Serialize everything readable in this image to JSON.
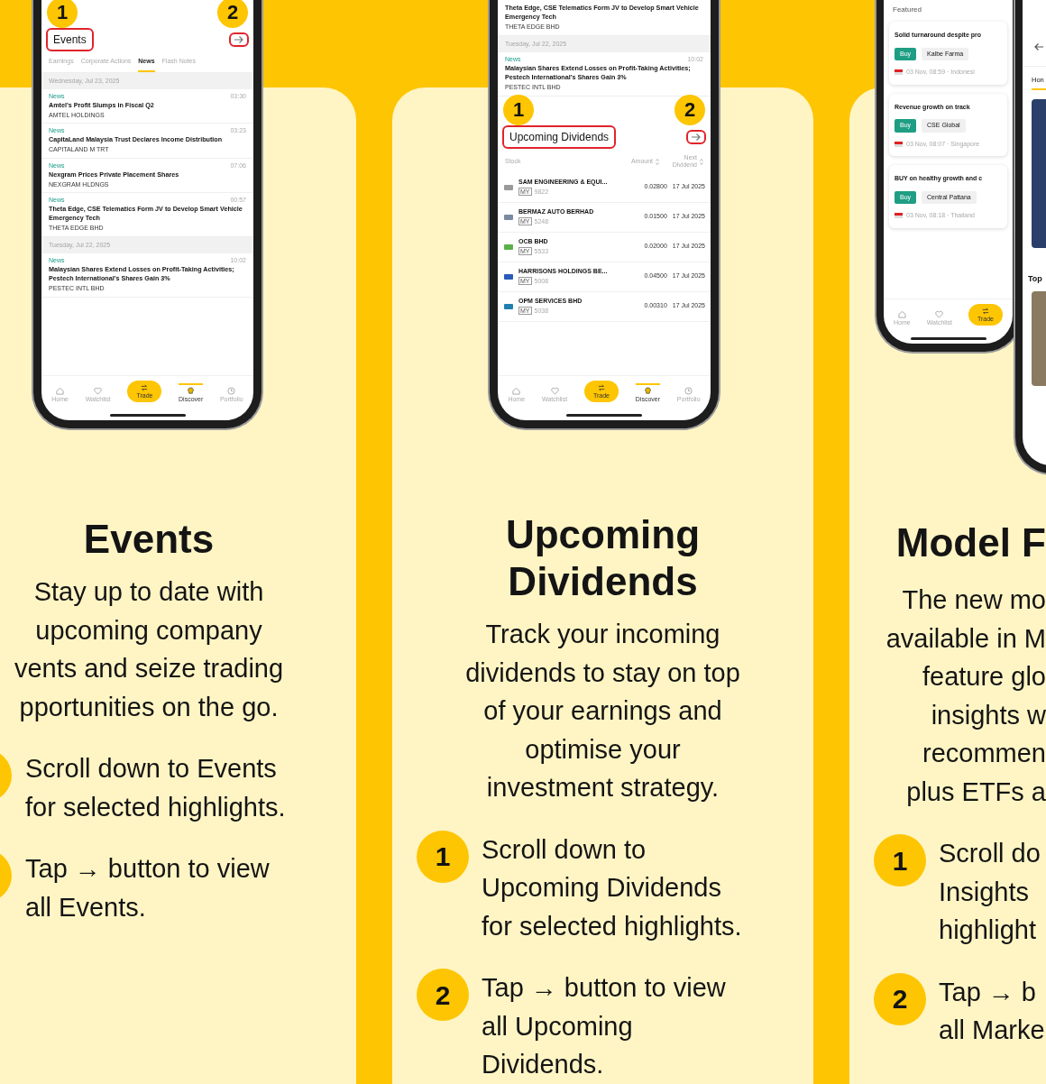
{
  "panels": [
    {
      "phone": {
        "kind": "events",
        "callouts": [
          "1",
          "2"
        ],
        "section_title": "Events",
        "tabs": [
          {
            "label": "Earnings",
            "selected": false
          },
          {
            "label": "Corporate Actions",
            "selected": false
          },
          {
            "label": "News",
            "selected": true
          },
          {
            "label": "Flash Notes",
            "selected": false
          }
        ],
        "feed": [
          {
            "kind": "date",
            "text": "Wednesday, Jul 23, 2025"
          },
          {
            "kind": "item",
            "tag": "News",
            "time": "03:30",
            "title": "Amtel's Profit Slumps in Fiscal Q2",
            "company": "AMTEL HOLDINGS"
          },
          {
            "kind": "item",
            "tag": "News",
            "time": "03:23",
            "title": "CapitaLand Malaysia Trust Declares Income Distribution",
            "company": "CAPITALAND M TRT"
          },
          {
            "kind": "item",
            "tag": "News",
            "time": "07:06",
            "title": "Nexgram Prices Private Placement Shares",
            "company": "NEXGRAM HLDNGS"
          },
          {
            "kind": "item",
            "tag": "News",
            "time": "00:57",
            "title": "Theta Edge, CSE Telematics Form JV to Develop Smart Vehicle Emergency Tech",
            "company": "THETA EDGE BHD"
          },
          {
            "kind": "date",
            "text": "Tuesday, Jul 22, 2025"
          },
          {
            "kind": "item",
            "tag": "News",
            "time": "10:02",
            "title": "Malaysian Shares Extend Losses on Profit-Taking Activities; Pestech International's Shares Gain 3%",
            "company": "PESTEC INTL BHD"
          }
        ],
        "nav": [
          {
            "label": "Home",
            "kind": "tab",
            "selected": false
          },
          {
            "label": "Watchlist",
            "kind": "tab",
            "selected": false
          },
          {
            "label": "Trade",
            "kind": "action",
            "selected": false
          },
          {
            "label": "Discover",
            "kind": "tab",
            "selected": true
          },
          {
            "label": "Portfolio",
            "kind": "tab",
            "selected": false
          }
        ]
      },
      "title": [
        "Events"
      ],
      "description": [
        "Stay up to date with",
        "upcoming company",
        "vents and seize trading",
        "pportunities on the go."
      ],
      "steps": [
        {
          "lines": [
            "Scroll down to Events",
            "for selected highlights."
          ]
        },
        {
          "lines": [
            "Tap → button to view",
            "all Events."
          ]
        }
      ]
    },
    {
      "phone": {
        "kind": "dividends",
        "callouts": [
          "1",
          "2"
        ],
        "section_title": "Upcoming Dividends",
        "feed": [
          {
            "kind": "item",
            "title": "Theta Edge, CSE Telematics Form JV to Develop Smart Vehicle Emergency Tech",
            "company": "THETA EDGE BHD"
          },
          {
            "kind": "date",
            "text": "Tuesday, Jul 22, 2025"
          },
          {
            "kind": "item",
            "tag": "News",
            "time": "10:02",
            "title": "Malaysian Shares Extend Losses on Profit-Taking Activities; Pestech International's Shares Gain 3%",
            "company": "PESTEC INTL BHD"
          }
        ],
        "columns": [
          "Stock",
          "Amount",
          "Next Dividend"
        ],
        "rows": [
          {
            "name": "SAM ENGINEERING & EQUI...",
            "market": "MY",
            "code": "9822",
            "amount": "0.02800",
            "date": "17 Jul 2025"
          },
          {
            "name": "BERMAZ AUTO BERHAD",
            "market": "MY",
            "code": "5248",
            "amount": "0.01500",
            "date": "17 Jul 2025"
          },
          {
            "name": "OCB BHD",
            "market": "MY",
            "code": "5533",
            "amount": "0.02000",
            "date": "17 Jul 2025"
          },
          {
            "name": "HARRISONS HOLDINGS BE...",
            "market": "MY",
            "code": "5008",
            "amount": "0.04500",
            "date": "17 Jul 2025"
          },
          {
            "name": "OPM SERVICES BHD",
            "market": "MY",
            "code": "5038",
            "amount": "0.00310",
            "date": "17 Jul 2025"
          }
        ],
        "nav": [
          {
            "label": "Home",
            "kind": "tab",
            "selected": false
          },
          {
            "label": "Watchlist",
            "kind": "tab",
            "selected": false
          },
          {
            "label": "Trade",
            "kind": "action",
            "selected": false
          },
          {
            "label": "Discover",
            "kind": "tab",
            "selected": true
          },
          {
            "label": "Portfolio",
            "kind": "tab",
            "selected": false
          }
        ]
      },
      "title": [
        "Upcoming",
        "Dividends"
      ],
      "description": [
        "Track your incoming",
        "dividends to stay on top",
        "of your earnings and",
        "optimise your",
        "investment strategy."
      ],
      "steps": [
        {
          "number": "1",
          "lines": [
            "Scroll down to",
            "Upcoming Dividends",
            "for selected highlights."
          ]
        },
        {
          "number": "2",
          "lines": [
            "Tap → button to view",
            "all Upcoming",
            "Dividends."
          ]
        }
      ]
    },
    {
      "phone": {
        "kind": "featured",
        "heading": "Featured",
        "cards": [
          {
            "title": "Solid turnaround despite pro",
            "rating": "Buy",
            "stock": "Kalbe Farma",
            "meta": "03 Nov, 08:59 · Indonesi"
          },
          {
            "title": "Revenue growth on track",
            "rating": "Buy",
            "stock": "CSE Global",
            "meta": "03 Nov, 08:07 · Singapore"
          },
          {
            "title": "BUY on healthy growth and c",
            "rating": "Buy",
            "stock": "Central Pattana",
            "meta": "03 Nov, 08:18 · Thailand"
          }
        ],
        "nav": [
          {
            "label": "Home",
            "kind": "tab",
            "selected": false
          },
          {
            "label": "Watchlist",
            "kind": "tab",
            "selected": false
          },
          {
            "label": "Trade",
            "kind": "action",
            "selected": false
          }
        ],
        "second_screen": {
          "tab": "Hon",
          "section": "Top"
        }
      },
      "title": [
        "Model F"
      ],
      "description": [
        "The new mo",
        "available in M",
        "feature glo",
        "insights w",
        "recommen",
        "plus ETFs a"
      ],
      "steps": [
        {
          "number": "1",
          "lines": [
            "Scroll do",
            "Insights",
            "highlight"
          ]
        },
        {
          "number": "2",
          "lines": [
            "Tap → b",
            "all Marke"
          ]
        }
      ]
    }
  ]
}
